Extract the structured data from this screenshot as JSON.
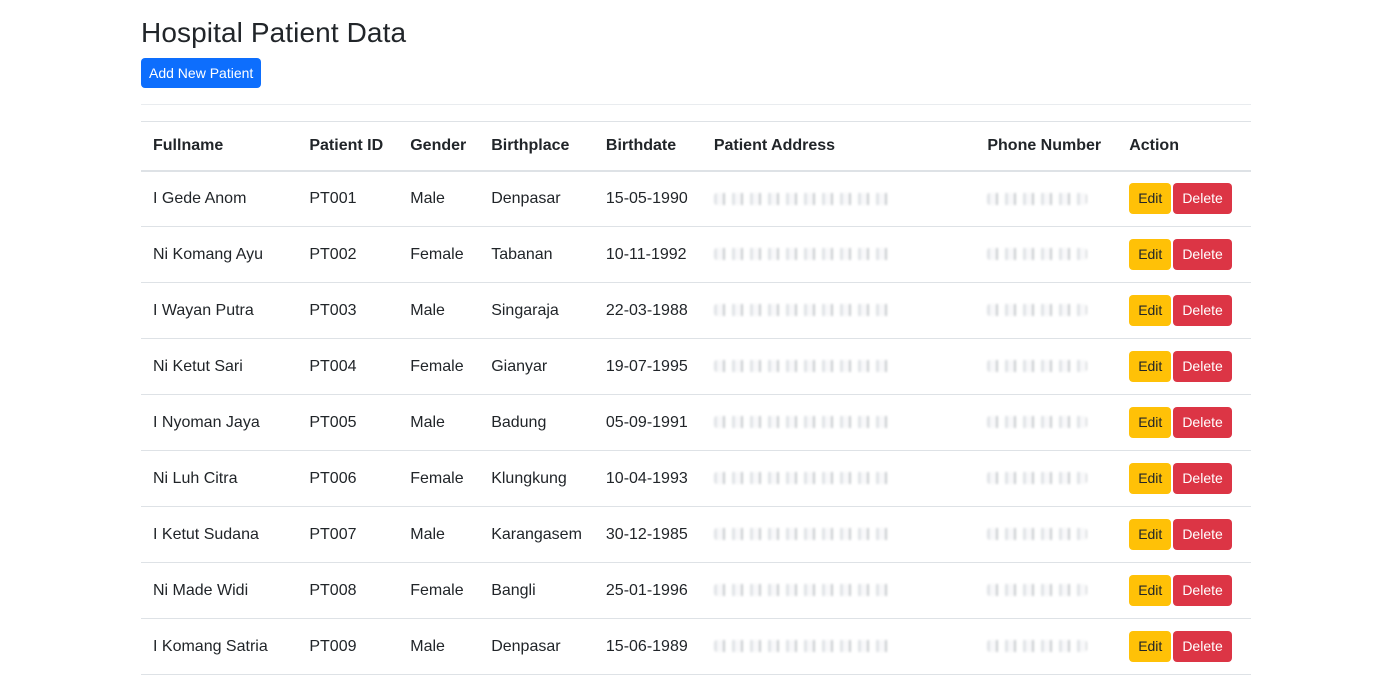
{
  "page": {
    "title": "Hospital Patient Data",
    "add_button_label": "Add New Patient"
  },
  "colors": {
    "primary": "#0d6efd",
    "warning": "#ffc107",
    "danger": "#dc3545"
  },
  "table": {
    "columns": [
      "Fullname",
      "Patient ID",
      "Gender",
      "Birthplace",
      "Birthdate",
      "Patient Address",
      "Phone Number",
      "Action"
    ],
    "edit_label": "Edit",
    "delete_label": "Delete",
    "rows": [
      {
        "fullname": "I Gede Anom",
        "patient_id": "PT001",
        "gender": "Male",
        "birthplace": "Denpasar",
        "birthdate": "15-05-1990"
      },
      {
        "fullname": "Ni Komang Ayu",
        "patient_id": "PT002",
        "gender": "Female",
        "birthplace": "Tabanan",
        "birthdate": "10-11-1992"
      },
      {
        "fullname": "I Wayan Putra",
        "patient_id": "PT003",
        "gender": "Male",
        "birthplace": "Singaraja",
        "birthdate": "22-03-1988"
      },
      {
        "fullname": "Ni Ketut Sari",
        "patient_id": "PT004",
        "gender": "Female",
        "birthplace": "Gianyar",
        "birthdate": "19-07-1995"
      },
      {
        "fullname": "I Nyoman Jaya",
        "patient_id": "PT005",
        "gender": "Male",
        "birthplace": "Badung",
        "birthdate": "05-09-1991"
      },
      {
        "fullname": "Ni Luh Citra",
        "patient_id": "PT006",
        "gender": "Female",
        "birthplace": "Klungkung",
        "birthdate": "10-04-1993"
      },
      {
        "fullname": "I Ketut Sudana",
        "patient_id": "PT007",
        "gender": "Male",
        "birthplace": "Karangasem",
        "birthdate": "30-12-1985"
      },
      {
        "fullname": "Ni Made Widi",
        "patient_id": "PT008",
        "gender": "Female",
        "birthplace": "Bangli",
        "birthdate": "25-01-1996"
      },
      {
        "fullname": "I Komang Satria",
        "patient_id": "PT009",
        "gender": "Male",
        "birthplace": "Denpasar",
        "birthdate": "15-06-1989"
      }
    ]
  }
}
